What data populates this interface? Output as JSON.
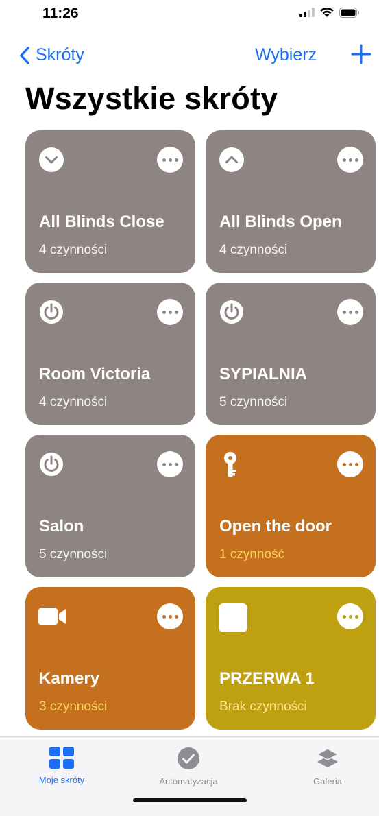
{
  "status_bar": {
    "time": "11:26"
  },
  "nav": {
    "back_label": "Skróty",
    "select_label": "Wybierz"
  },
  "page_title": "Wszystkie skróty",
  "cards": [
    {
      "label": "All Blinds Close",
      "subtitle": "4 czynności",
      "icon": "chevron-down-icon",
      "color": "#8e8583"
    },
    {
      "label": "All Blinds Open",
      "subtitle": "4 czynności",
      "icon": "chevron-up-icon",
      "color": "#8e8583"
    },
    {
      "label": "Room Victoria",
      "subtitle": "4 czynności",
      "icon": "power-icon",
      "color": "#8e8583"
    },
    {
      "label": "SYPIALNIA",
      "subtitle": "5 czynności",
      "icon": "power-icon",
      "color": "#8e8583"
    },
    {
      "label": "Salon",
      "subtitle": "5 czynności",
      "icon": "power-icon",
      "color": "#8e8583"
    },
    {
      "label": "Open the door",
      "subtitle": "1 czynność",
      "icon": "key-icon",
      "color": "#c4701f"
    },
    {
      "label": "Kamery",
      "subtitle": "3 czynności",
      "icon": "video-camera-icon",
      "color": "#c4701f"
    },
    {
      "label": "PRZERWA 1",
      "subtitle": "Brak czynności",
      "icon": "square-icon",
      "color": "#bfa010"
    }
  ],
  "tabs": [
    {
      "label": "Moje skróty",
      "icon": "grid-icon",
      "active": true
    },
    {
      "label": "Automatyzacja",
      "icon": "clock-check-icon",
      "active": false
    },
    {
      "label": "Galeria",
      "icon": "layers-icon",
      "active": false
    }
  ],
  "colors": {
    "accent": "#1a6ef5",
    "card_gray": "#8e8583",
    "card_orange": "#c4701f",
    "card_yellow": "#bfa010"
  }
}
